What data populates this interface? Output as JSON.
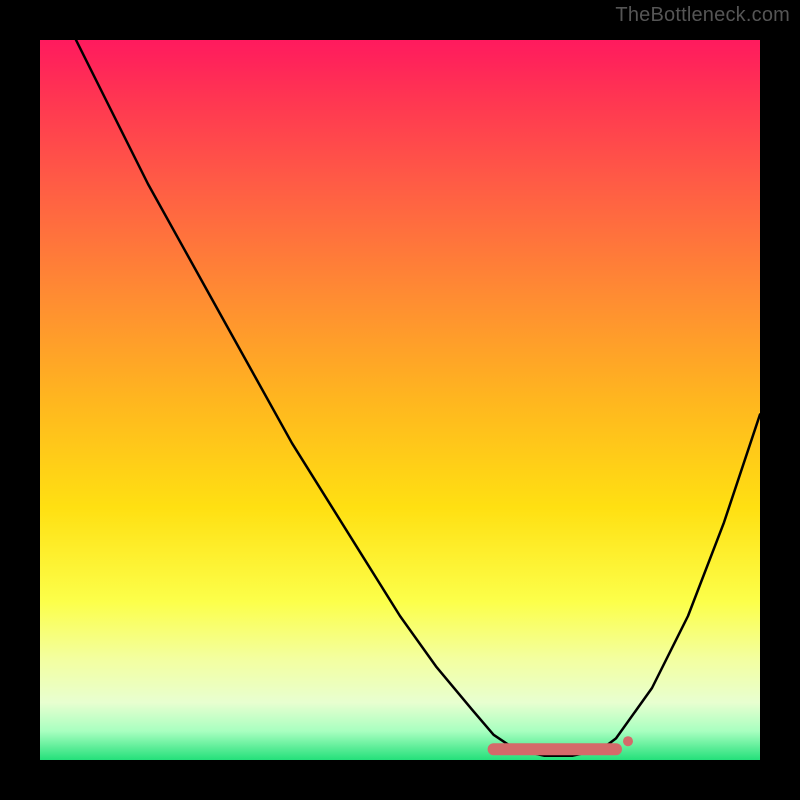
{
  "watermark": "TheBottleneck.com",
  "chart_data": {
    "type": "line",
    "title": "",
    "xlabel": "",
    "ylabel": "",
    "xlim": [
      0,
      100
    ],
    "ylim": [
      0,
      100
    ],
    "series": [
      {
        "name": "curve",
        "x": [
          5,
          10,
          15,
          20,
          25,
          30,
          35,
          40,
          45,
          50,
          55,
          60,
          63,
          66,
          70,
          74,
          78,
          80,
          85,
          90,
          95,
          100
        ],
        "y": [
          100,
          90,
          80,
          71,
          62,
          53,
          44,
          36,
          28,
          20,
          13,
          7,
          3.5,
          1.5,
          0.6,
          0.6,
          1.5,
          3,
          10,
          20,
          33,
          48
        ]
      }
    ],
    "flat_segment": {
      "x_start": 63,
      "x_end": 80,
      "y": 1.5,
      "color": "#d46a6a",
      "stroke_width": 12
    },
    "colors": {
      "curve": "#000000",
      "background_top": "#ff1a5e",
      "background_bottom": "#24e07a"
    }
  }
}
